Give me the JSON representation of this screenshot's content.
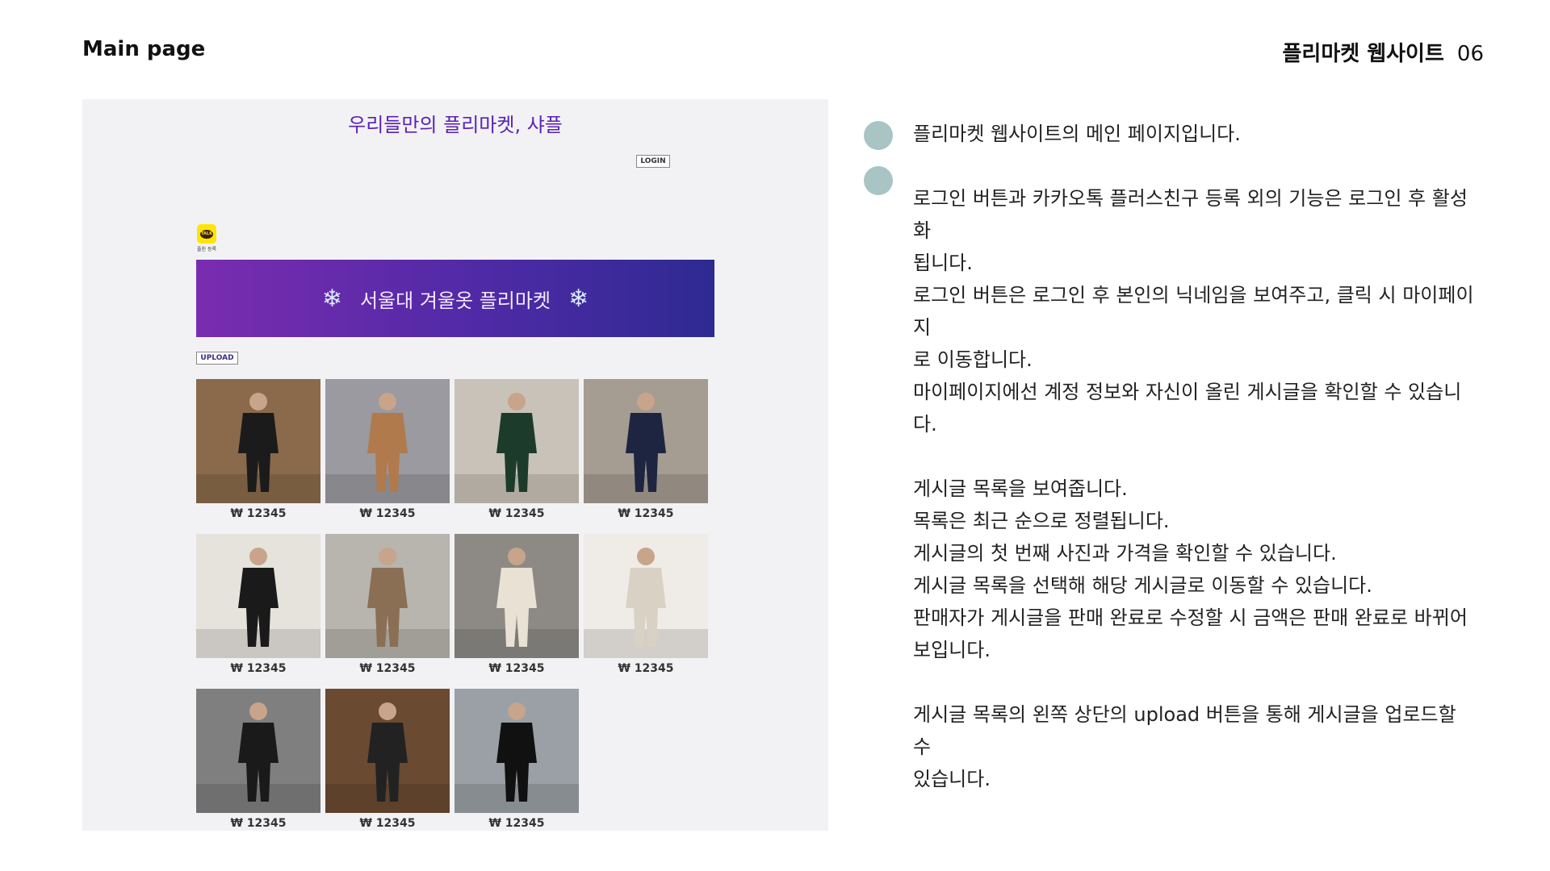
{
  "header": {
    "title": "Main page",
    "project": "플리마켓 웹사이트",
    "page_number": "06"
  },
  "site": {
    "title": "우리들만의 플리마켓, 샤플",
    "login_label": "LOGIN",
    "kakao_label": "플친 등록",
    "kakao_icon_text": "TALK",
    "banner_text": "서울대 겨울옷 플리마켓",
    "upload_label": "UPLOAD",
    "items": [
      {
        "price": "₩ 12345",
        "bg": "#8a6a4a",
        "fig": "#1b1b1b"
      },
      {
        "price": "₩ 12345",
        "bg": "#9a9aa0",
        "fig": "#b07a4c"
      },
      {
        "price": "₩ 12345",
        "bg": "#c9c2b8",
        "fig": "#1d3b2a"
      },
      {
        "price": "₩ 12345",
        "bg": "#a59c92",
        "fig": "#1e2540"
      },
      {
        "price": "₩ 12345",
        "bg": "#e6e2dc",
        "fig": "#1a1a1a"
      },
      {
        "price": "₩ 12345",
        "bg": "#b8b4ae",
        "fig": "#8a6f55"
      },
      {
        "price": "₩ 12345",
        "bg": "#8d8a86",
        "fig": "#e8e1d4"
      },
      {
        "price": "₩ 12345",
        "bg": "#efece7",
        "fig": "#d9d1c3"
      },
      {
        "price": "₩ 12345",
        "bg": "#7f7f80",
        "fig": "#1a1a1a"
      },
      {
        "price": "₩ 12345",
        "bg": "#6b4a32",
        "fig": "#222222"
      },
      {
        "price": "₩ 12345",
        "bg": "#9aa0a6",
        "fig": "#111111"
      }
    ]
  },
  "description": {
    "para1": [
      "플리마켓 웹사이트의 메인 페이지입니다."
    ],
    "para2": [
      "로그인 버튼과 카카오톡 플러스친구 등록 외의 기능은 로그인 후 활성화",
      "됩니다.",
      "로그인 버튼은 로그인 후 본인의 닉네임을 보여주고, 클릭 시 마이페이지",
      "로 이동합니다.",
      "마이페이지에선 계정 정보와 자신이 올린 게시글을 확인할 수 있습니다."
    ],
    "para3": [
      "게시글 목록을 보여줍니다.",
      "목록은 최근 순으로 정렬됩니다.",
      "게시글의 첫 번째 사진과 가격을 확인할 수 있습니다.",
      "게시글 목록을 선택해 해당 게시글로 이동할 수 있습니다.",
      "판매자가 게시글을 판매 완료로 수정할 시 금액은 판매 완료로 바뀌어",
      "보입니다."
    ],
    "para4": [
      "게시글 목록의 왼쪽 상단의 upload 버튼을 통해 게시글을 업로드할 수",
      "있습니다."
    ]
  },
  "colors": {
    "accent": "#5b21b6",
    "bullet": "#a9c4c4"
  }
}
